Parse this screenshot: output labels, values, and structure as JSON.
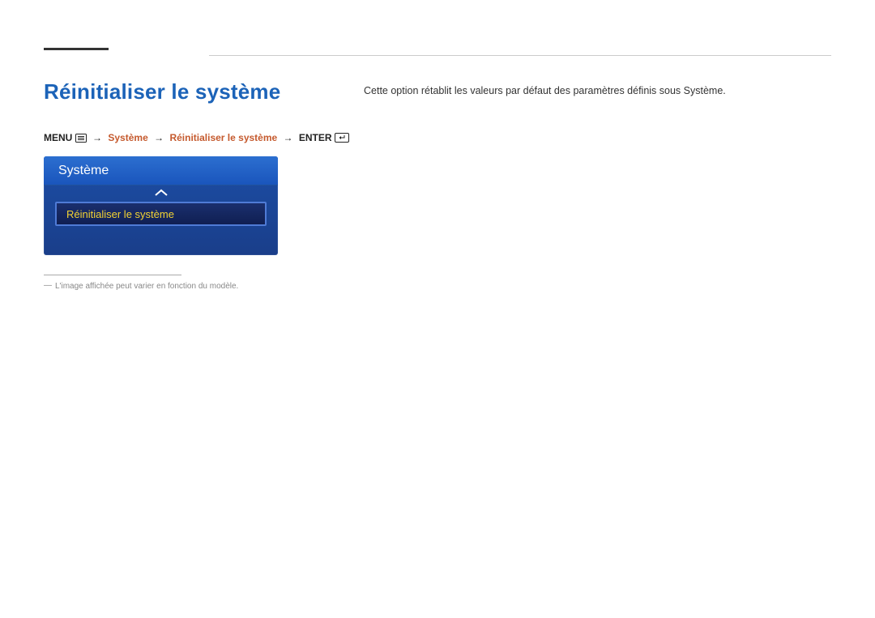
{
  "heading": "Réinitialiser le système",
  "breadcrumb": {
    "menu": "MENU",
    "sep": "→",
    "path1": "Système",
    "path2": "Réinitialiser le système",
    "enter": "ENTER"
  },
  "osd": {
    "header": "Système",
    "item": "Réinitialiser le système"
  },
  "footnote": {
    "dash": "―",
    "text": "L'image affichée peut varier en fonction du modèle."
  },
  "description": "Cette option rétablit les valeurs par défaut des paramètres définis sous Système."
}
